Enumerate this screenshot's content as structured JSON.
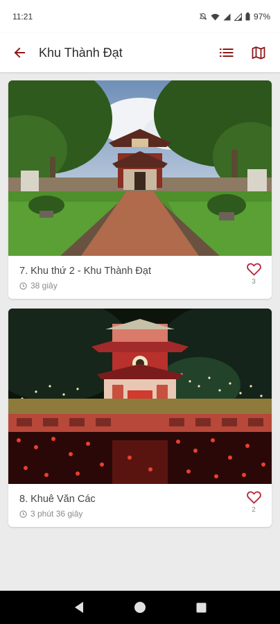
{
  "status_bar": {
    "time": "11:21",
    "battery": "97%"
  },
  "app_bar": {
    "title": "Khu Thành Đạt",
    "icons": [
      "back-arrow-icon",
      "list-icon",
      "map-icon"
    ],
    "accent_color": "#8b1a1a"
  },
  "cards": [
    {
      "title": "7. Khu thứ 2 - Khu Thành Đạt",
      "duration": "38 giây",
      "likes": "3"
    },
    {
      "title": "8. Khuê Văn Các",
      "duration": "3 phút 36 giây",
      "likes": "2"
    }
  ]
}
